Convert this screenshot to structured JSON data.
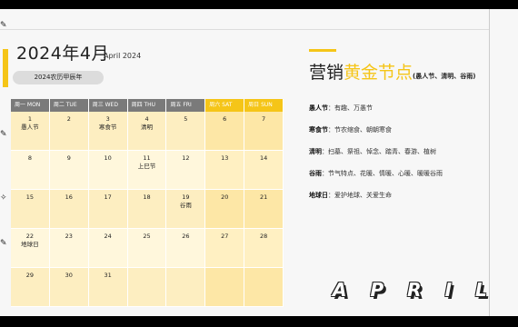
{
  "header": {
    "year_month": "2024年4月",
    "english_month": "April 2024",
    "lunar": "2024农历甲辰年"
  },
  "calendar": {
    "weekdays": [
      "周一 MON",
      "周二 TUE",
      "周三 WED",
      "周四 THU",
      "周五 FRI",
      "周六 SAT",
      "周日 SUN"
    ],
    "weeks": [
      [
        {
          "d": "1",
          "n": "愚人节"
        },
        {
          "d": "2",
          "n": ""
        },
        {
          "d": "3",
          "n": "寒食节"
        },
        {
          "d": "4",
          "n": "清明"
        },
        {
          "d": "5",
          "n": ""
        },
        {
          "d": "6",
          "n": ""
        },
        {
          "d": "7",
          "n": ""
        }
      ],
      [
        {
          "d": "8",
          "n": ""
        },
        {
          "d": "9",
          "n": ""
        },
        {
          "d": "10",
          "n": ""
        },
        {
          "d": "11",
          "n": "上巳节"
        },
        {
          "d": "12",
          "n": ""
        },
        {
          "d": "13",
          "n": ""
        },
        {
          "d": "14",
          "n": ""
        }
      ],
      [
        {
          "d": "15",
          "n": ""
        },
        {
          "d": "16",
          "n": ""
        },
        {
          "d": "17",
          "n": ""
        },
        {
          "d": "18",
          "n": ""
        },
        {
          "d": "19",
          "n": "谷雨"
        },
        {
          "d": "20",
          "n": ""
        },
        {
          "d": "21",
          "n": ""
        }
      ],
      [
        {
          "d": "22",
          "n": "地球日"
        },
        {
          "d": "23",
          "n": ""
        },
        {
          "d": "24",
          "n": ""
        },
        {
          "d": "25",
          "n": ""
        },
        {
          "d": "26",
          "n": ""
        },
        {
          "d": "27",
          "n": ""
        },
        {
          "d": "28",
          "n": ""
        }
      ],
      [
        {
          "d": "29",
          "n": ""
        },
        {
          "d": "30",
          "n": ""
        },
        {
          "d": "31",
          "n": ""
        },
        {
          "d": "",
          "n": ""
        },
        {
          "d": "",
          "n": ""
        },
        {
          "d": "",
          "n": ""
        },
        {
          "d": "",
          "n": ""
        }
      ]
    ]
  },
  "marketing": {
    "title_plain": "营销",
    "title_highlight": "黄金节点",
    "title_sub": "(愚人节、清明、谷雨)",
    "items": [
      {
        "name": "愚人节",
        "text": "：有趣、万愚节"
      },
      {
        "name": "寒食节",
        "text": "：节农缩食、朝朝寒食"
      },
      {
        "name": "清明",
        "text": "：扫墓、祭祖、悼念、踏青、春游、植树"
      },
      {
        "name": "谷雨",
        "text": "：节气特点、花暖、情暖、心暖、暖暖谷雨"
      },
      {
        "name": "地球日",
        "text": "：爱护地球、关爱生命"
      }
    ]
  },
  "decor_word": [
    "A",
    "P",
    "R",
    "I",
    "L"
  ],
  "colors": {
    "accent": "#f5c518",
    "header_gray": "#7a7a7a"
  }
}
